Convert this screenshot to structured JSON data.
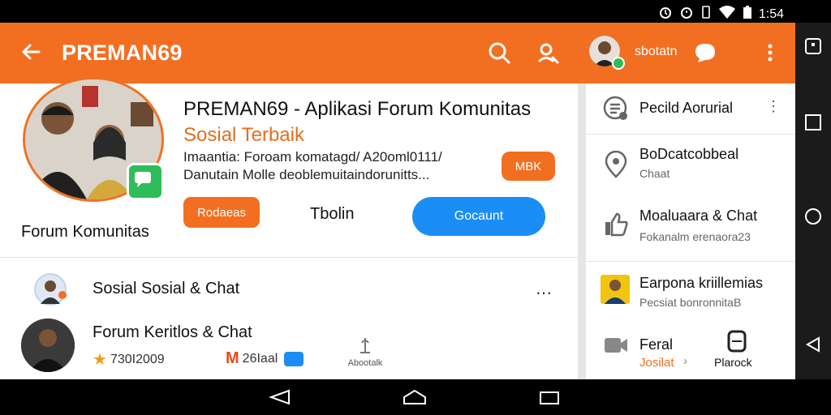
{
  "status_bar": {
    "time": "1:54"
  },
  "header": {
    "title": "PREMAN69",
    "status_text": "sbotatn",
    "accent_color": "#f26f22"
  },
  "profile": {
    "forum_label": "Forum Komunitas",
    "headline": "PREMAN69 - Aplikasi Forum Komunitas",
    "subheadline": "Sosial Terbaik",
    "description_line1": "Imaantia: Foroam komatagd/ A20oml0111/",
    "description_line2": "Danutain Molle deoblemuitaindorunitts...",
    "badge_button": "MBK",
    "left_button": "Rodaeas",
    "middle_text": "Tbolin",
    "primary_button": "Gocaunt"
  },
  "feed": [
    {
      "text": "Sosial Sosial & Chat",
      "more": "⋯"
    },
    {
      "text": "Forum Keritlos & Chat",
      "stat1": "730I2009",
      "stat2": "26Iaal",
      "icon_label": "Abootalk"
    }
  ],
  "sidebar": {
    "items": [
      {
        "title": "Pecild Aorurial",
        "subtitle": ""
      },
      {
        "title": "BoDcatcobbeal",
        "subtitle": "Chaat"
      },
      {
        "title": "Moaluaara & Chat",
        "subtitle": "Fokanalm erenaora23"
      },
      {
        "title": "Earpona kriillemias",
        "subtitle": "Pecsiat bonronnitaB"
      },
      {
        "title": "Feral",
        "subtitle": "Josilat",
        "extra": "Plarock"
      }
    ]
  }
}
